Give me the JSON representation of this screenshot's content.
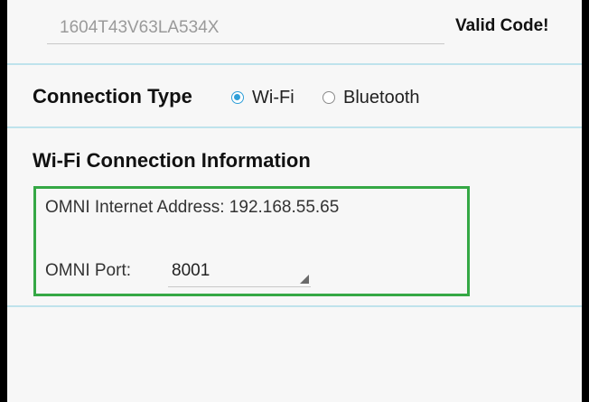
{
  "code": {
    "value": "1604T43V63LA534X",
    "status": "Valid Code!"
  },
  "connection": {
    "label": "Connection Type",
    "options": [
      {
        "label": "Wi-Fi",
        "selected": true
      },
      {
        "label": "Bluetooth",
        "selected": false
      }
    ]
  },
  "wifi": {
    "heading": "Wi-Fi Connection Information",
    "address_text": "OMNI Internet Address: 192.168.55.65",
    "port_label": "OMNI Port:",
    "port_value": "8001"
  },
  "colors": {
    "accent": "#2f9fd8",
    "divider": "#bfe3ec",
    "highlight_box": "#35a845",
    "background": "#f7f7f7"
  },
  "icons": {
    "radio_selected": "radio-selected-icon",
    "radio_unselected": "radio-unselected-icon",
    "spinner_arrow": "dropdown-triangle-icon"
  }
}
